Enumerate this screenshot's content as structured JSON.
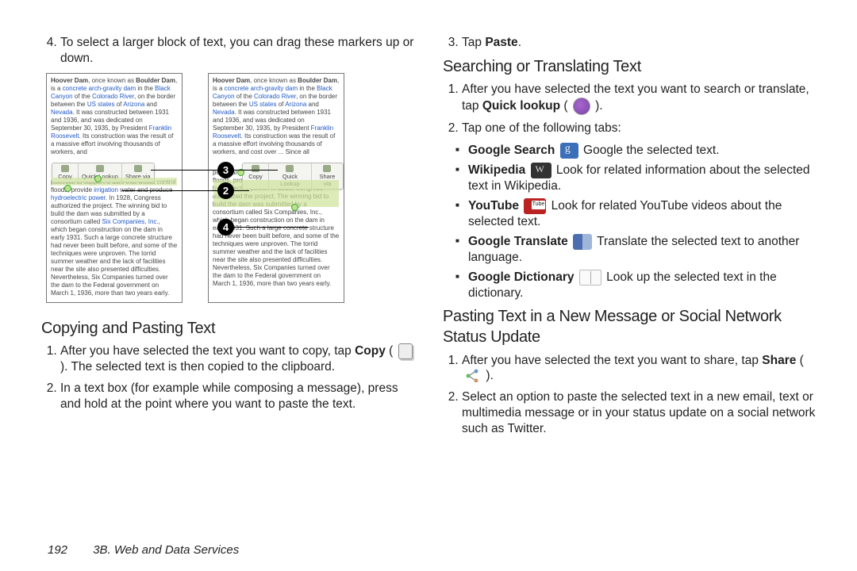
{
  "left": {
    "top_item_number": "4.",
    "top_item_text": "To select a larger block of text, you can drag these markers up or down.",
    "shot_sample_intro": "Hoover Dam, once known as Boulder Dam, is a concrete arch-gravity dam in the Black Canyon of the Colorado River, on the border between the US states of Arizona and Nevada. It was constructed between 1931 and 1936, and was dedicated on September 30, 1935, by President Franklin Roosevelt. Its construction was the result of a massive effort involving thousands of workers, and cost over",
    "shot_sample_mid": "and nearby ... for their potential to support a dam that would control floods, provide irrigation water and produce hydroelectric power. In 1928, Congress authorized the project. The winning bid to build the dam was submitted by a consortium called Six Companies, Inc., which began construction on the dam in early 1931. Such a large concrete structure had never been built before, and some of the techniques were unproven. The torrid summer weather and the lack of facilities near the site also presented difficulties. Nevertheless, Six Companies turned over the dam to the Federal government on March 1, 1936, more than two years early.",
    "popup_copy": "Copy",
    "popup_quick": "Quick Lookup",
    "popup_share": "Share via",
    "callout3": "3",
    "callout2": "2",
    "callout4": "4",
    "heading_copy": "Copying and Pasting Text",
    "copy1a": "After you have selected the text you want to copy, tap ",
    "copy1_bold": "Copy",
    "copy1b": " ( ",
    "copy1c": " ). The selected text is then copied to the clipboard.",
    "copy2": "In a text box (for example while composing a message), press and hold at the point where you want to paste the text."
  },
  "right": {
    "paste_num": "3.",
    "paste_a": "Tap ",
    "paste_b": "Paste",
    "paste_c": ".",
    "heading_search": "Searching or Translating Text",
    "s1a": "After you have selected the text you want to search or translate, tap ",
    "s1_bold": "Quick lookup",
    "s1b": " ( ",
    "s1c": " ).",
    "s2": "Tap one of the following tabs:",
    "bul_gs_lbl": "Google Search",
    "bul_gs_txt": " Google the selected text.",
    "bul_wk_lbl": "Wikipedia",
    "bul_wk_txt": " Look for related information about the selected text in Wikipedia.",
    "bul_yt_lbl": "YouTube",
    "bul_yt_txt": " Look for related YouTube videos about the selected text.",
    "bul_tr_lbl": "Google Translate",
    "bul_tr_txt": " Translate the selected text to another language.",
    "bul_dc_lbl": "Google Dictionary",
    "bul_dc_txt": " Look up the selected text in the dictionary.",
    "heading_paste2": "Pasting Text in a New Message or Social Network Status Update",
    "p1a": "After you have selected the text you want to share, tap ",
    "p1_bold": "Share",
    "p1b": " ( ",
    "p1c": " ).",
    "p2": "Select an option to paste the selected text in a new email, text or multimedia message or in your status update on a social network such as Twitter."
  },
  "footer": {
    "page": "192",
    "section": "3B. Web and Data Services"
  }
}
